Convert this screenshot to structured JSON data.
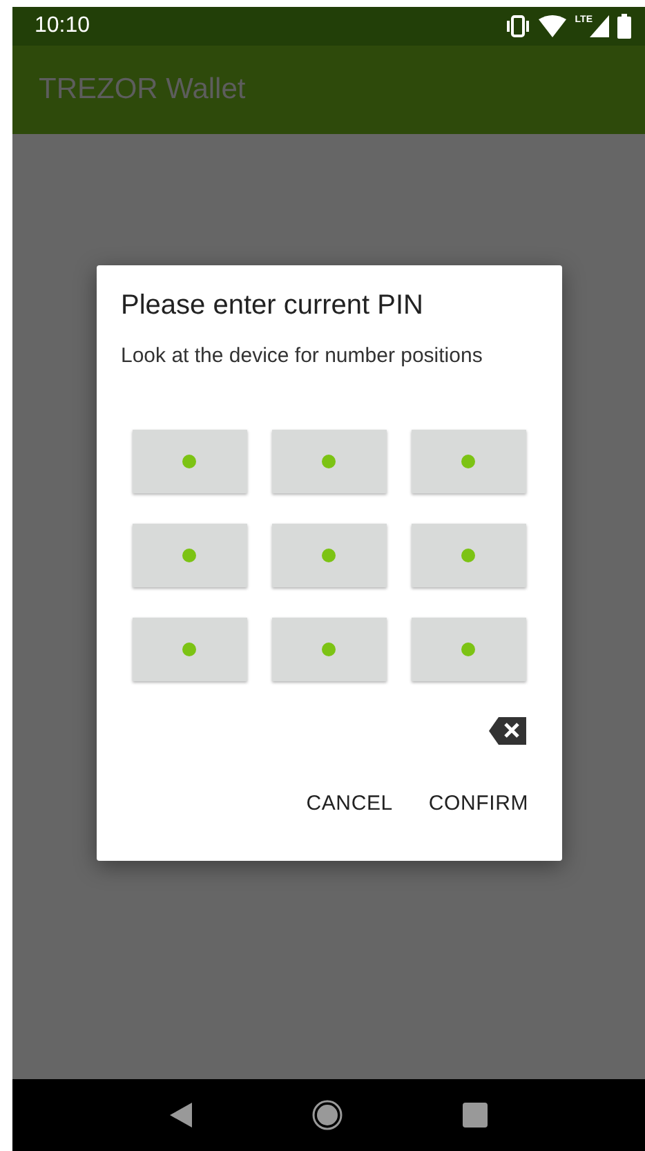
{
  "status_bar": {
    "time": "10:10",
    "network": "LTE"
  },
  "app_bar": {
    "title": "TREZOR Wallet"
  },
  "dialog": {
    "title": "Please enter current PIN",
    "message": "Look at the device for number positions",
    "buttons": [
      "CANCEL",
      "CONFIRM"
    ]
  }
}
